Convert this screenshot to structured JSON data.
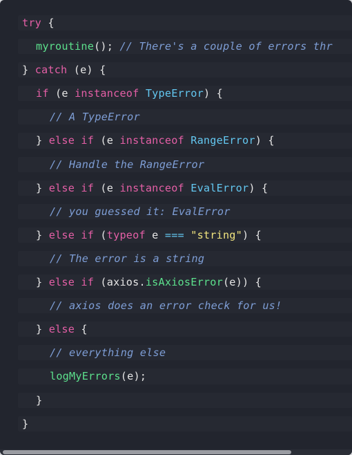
{
  "colors": {
    "background": "#22252e",
    "keyword": "#e45fa6",
    "function": "#5ce08c",
    "class": "#63c7f0",
    "comment": "#7e9ed6",
    "string": "#f1e47f",
    "plain": "#e6e6e6"
  },
  "code": {
    "l1": {
      "kw": "try",
      "p1": " {"
    },
    "l2": {
      "fn": "myroutine",
      "p1": "(); ",
      "cm": "// There's a couple of errors thr"
    },
    "l3": {
      "p1": "} ",
      "kw": "catch",
      "p2": " (e) {"
    },
    "l4": {
      "kw1": "if",
      "p1": " (e ",
      "kw2": "instanceof",
      "p2": " ",
      "cls": "TypeError",
      "p3": ") {"
    },
    "l5": {
      "cm": "// A TypeError"
    },
    "l6": {
      "p1": "} ",
      "kw1": "else",
      "p2": " ",
      "kw2": "if",
      "p3": " (e ",
      "kw3": "instanceof",
      "p4": " ",
      "cls": "RangeError",
      "p5": ") {"
    },
    "l7": {
      "cm": "// Handle the RangeError"
    },
    "l8": {
      "p1": "} ",
      "kw1": "else",
      "p2": " ",
      "kw2": "if",
      "p3": " (e ",
      "kw3": "instanceof",
      "p4": " ",
      "cls": "EvalError",
      "p5": ") {"
    },
    "l9": {
      "cm": "// you guessed it: EvalError"
    },
    "l10": {
      "p1": "} ",
      "kw1": "else",
      "p2": " ",
      "kw2": "if",
      "p3": " (",
      "kw3": "typeof",
      "p4": " e ",
      "op": "===",
      "p5": " ",
      "str": "\"string\"",
      "p6": ") {"
    },
    "l11": {
      "cm": "// The error is a string"
    },
    "l12": {
      "p1": "} ",
      "kw1": "else",
      "p2": " ",
      "kw2": "if",
      "p3": " (axios.",
      "fn": "isAxiosError",
      "p4": "(e)) {"
    },
    "l13": {
      "cm": "// axios does an error check for us!"
    },
    "l14": {
      "p1": "} ",
      "kw": "else",
      "p2": " {"
    },
    "l15": {
      "cm": "// everything else"
    },
    "l16": {
      "fn": "logMyErrors",
      "p1": "(e);"
    },
    "l17": {
      "p1": "}"
    },
    "l18": {
      "p1": "}"
    }
  }
}
